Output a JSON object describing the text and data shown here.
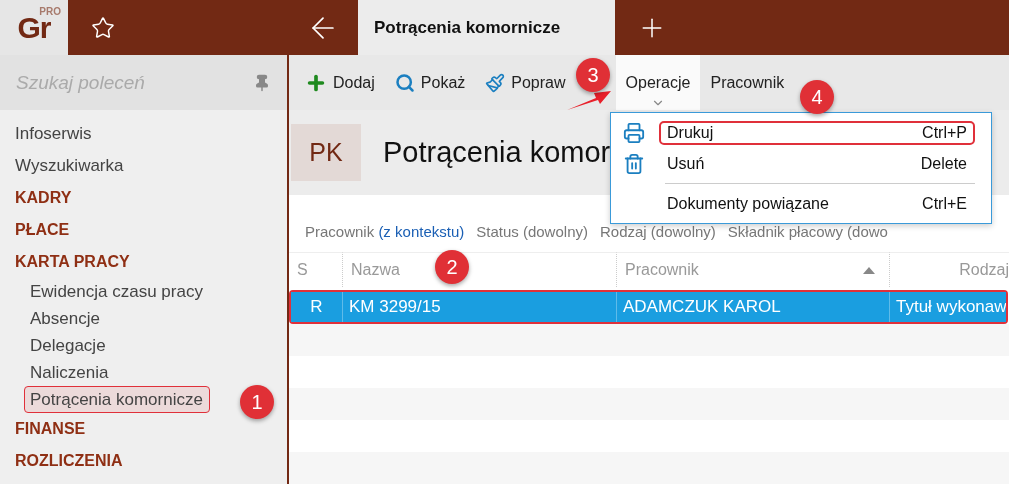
{
  "logo": {
    "text": "Gr",
    "badge": "PRO"
  },
  "tabs": [
    {
      "label": "Potrącenia komornicze",
      "selected": true
    }
  ],
  "sidebar": {
    "search": {
      "placeholder": "Szukaj poleceń"
    },
    "items": [
      {
        "kind": "link",
        "label": "Infoserwis",
        "highlighted": false
      },
      {
        "kind": "link",
        "label": "Wyszukiwarka",
        "highlighted": false
      },
      {
        "kind": "section",
        "label": "KADRY",
        "highlighted": false
      },
      {
        "kind": "section",
        "label": "PŁACE",
        "highlighted": false
      },
      {
        "kind": "section",
        "label": "KARTA PRACY",
        "highlighted": false
      },
      {
        "kind": "sub",
        "label": "Ewidencja czasu pracy",
        "highlighted": false
      },
      {
        "kind": "sub",
        "label": "Absencje",
        "highlighted": false
      },
      {
        "kind": "sub",
        "label": "Delegacje",
        "highlighted": false
      },
      {
        "kind": "sub",
        "label": "Naliczenia",
        "highlighted": false
      },
      {
        "kind": "sub",
        "label": "Potrącenia komornicze",
        "highlighted": true
      },
      {
        "kind": "section",
        "label": "FINANSE",
        "highlighted": false
      },
      {
        "kind": "section",
        "label": "ROZLICZENIA",
        "highlighted": false
      }
    ]
  },
  "toolbar": [
    {
      "kind": "add",
      "label": "Dodaj",
      "selected": false
    },
    {
      "kind": "view",
      "label": "Pokaż",
      "selected": false
    },
    {
      "kind": "edit",
      "label": "Popraw",
      "selected": false
    },
    {
      "kind": "menu",
      "label": "Operacje",
      "selected": true
    },
    {
      "kind": "text",
      "label": "Pracownik",
      "selected": false
    }
  ],
  "header": {
    "badge": "PK",
    "title": "Potrącenia komor"
  },
  "filters": [
    {
      "label": "Pracownik",
      "value": "(z kontekstu)"
    },
    {
      "label": "Status (dowolny)"
    },
    {
      "label": "Rodzaj (dowolny)"
    },
    {
      "label": "Składnik płacowy (dowo"
    }
  ],
  "table": {
    "columns": [
      {
        "label": "S",
        "sorted": false
      },
      {
        "label": "Nazwa",
        "sorted": false
      },
      {
        "label": "Pracownik",
        "sorted": true
      },
      {
        "label": "Rodzaj",
        "sorted": false
      }
    ],
    "rows": [
      {
        "cells": [
          "R",
          "KM 3299/15",
          "ADAMCZUK KAROL",
          "Tytuł wykonaw"
        ],
        "selected": true
      }
    ]
  },
  "menu": {
    "items": [
      {
        "kind": "print",
        "label": "Drukuj",
        "shortcut": "Ctrl+P",
        "highlighted": true
      },
      {
        "kind": "delete",
        "label": "Usuń",
        "shortcut": "Delete",
        "highlighted": false
      },
      {
        "kind": "separator"
      },
      {
        "kind": "plain",
        "label": "Dokumenty powiązane",
        "shortcut": "Ctrl+E",
        "highlighted": false
      }
    ]
  },
  "annotations": [
    {
      "label": "1"
    },
    {
      "label": "2"
    },
    {
      "label": "3"
    },
    {
      "label": "4"
    }
  ]
}
